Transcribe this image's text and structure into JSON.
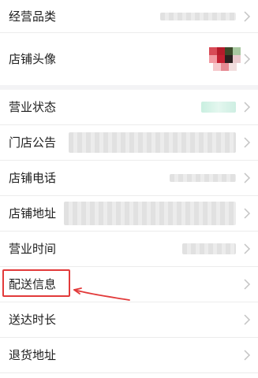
{
  "section_1": [
    {
      "label": "经营品类"
    },
    {
      "label": "店铺头像"
    }
  ],
  "section_2": [
    {
      "label": "营业状态"
    },
    {
      "label": "门店公告"
    },
    {
      "label": "店铺电话"
    },
    {
      "label": "店铺地址"
    },
    {
      "label": "营业时间"
    },
    {
      "label": "配送信息"
    },
    {
      "label": "送达时长"
    },
    {
      "label": "退货地址"
    }
  ],
  "colors": {
    "highlight": "#e23a3a",
    "chevron": "#c4c4c4",
    "status_blur": "#c9efe0"
  },
  "icons": [
    "chevron-right-icon",
    "annotation-arrow-icon"
  ]
}
